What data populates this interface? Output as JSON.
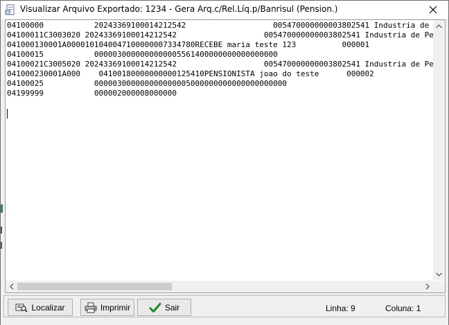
{
  "window": {
    "title": "Visualizar Arquivo Exportado: 1234 - Gera Arq.c/Rel.Líq.p/Banrisul (Pension.)"
  },
  "content": {
    "lines": [
      "04100000           20243369100014212542                   005470000000003802541 Industria de Pele",
      "04100011C3003020 20243369100014212542                   005470000000003802541 Industria de Pele",
      "041000130001A0000101040047100000007334780RECEBE maria teste 123          000001",
      "04100015           0000030000000000005561400000000000000000",
      "04100021C3005020 20243369100014212542                   005470000000003802541 Industria de Pele",
      "041000230001A000    04100180000000000125410PENSIONISTA joao do teste      000002",
      "04100025           000003000000000000005000000000000000000000",
      "04199999           000002000008000000"
    ]
  },
  "toolbar": {
    "localizar_label": "Localizar",
    "imprimir_label": "Imprimir",
    "sair_label": "Sair"
  },
  "status": {
    "linha": "Linha: 9",
    "coluna": "Coluna: 1"
  },
  "colors": {
    "sair_check": "#1f8a1f",
    "scroll_thumb": "#cdcdcd"
  }
}
